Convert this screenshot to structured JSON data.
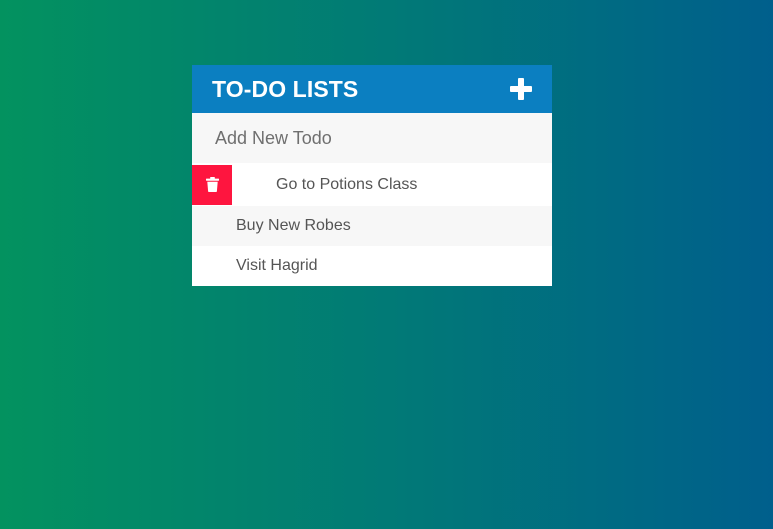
{
  "header": {
    "title": "TO-DO LISTS",
    "add_icon": "plus-icon"
  },
  "new_todo": {
    "placeholder": "Add New Todo",
    "value": ""
  },
  "todos": [
    {
      "label": "Go to Potions Class",
      "delete_revealed": true,
      "delete_icon": "trash-icon"
    },
    {
      "label": "Buy New Robes",
      "delete_revealed": false
    },
    {
      "label": "Visit Hagrid",
      "delete_revealed": false
    }
  ],
  "colors": {
    "header_bg": "#0b7fc1",
    "delete_bg": "#fe153f",
    "gradient_start": "#03925f",
    "gradient_end": "#005f8c"
  }
}
